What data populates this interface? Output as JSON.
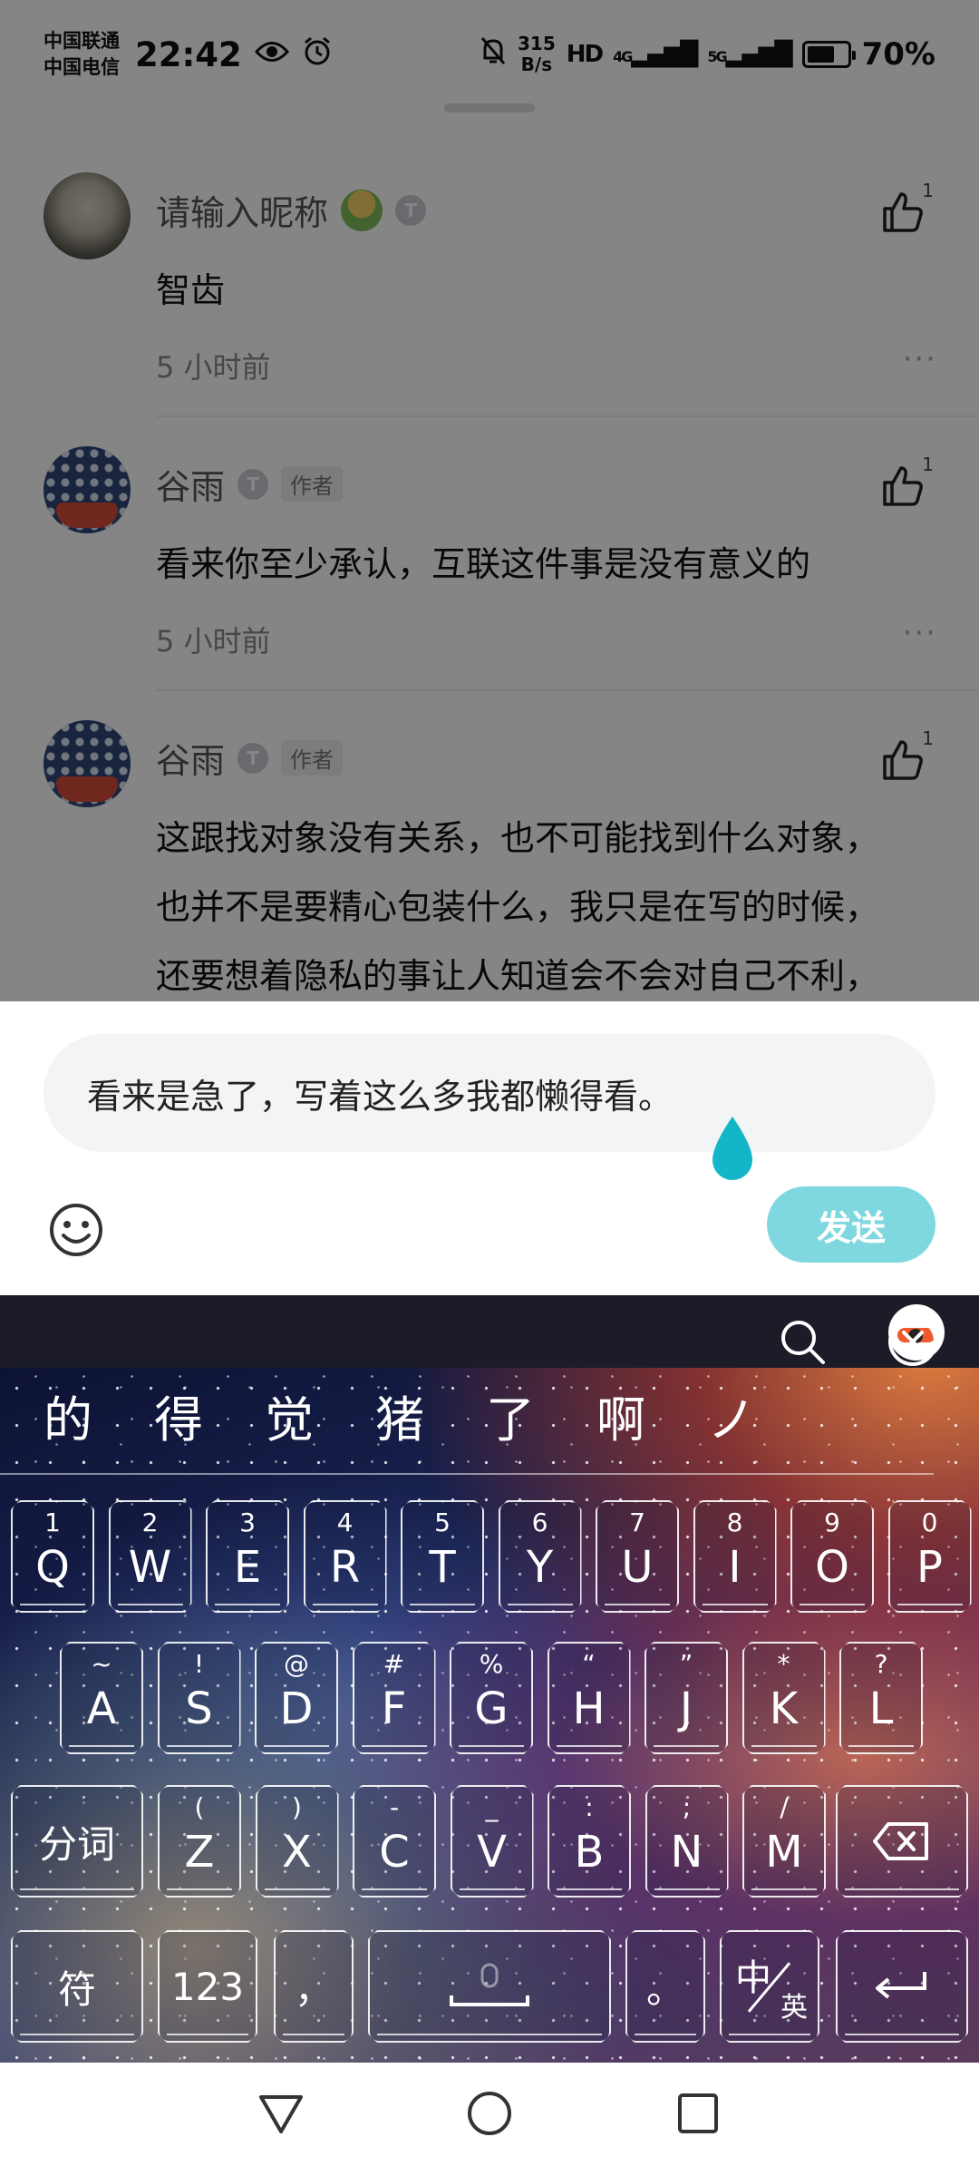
{
  "status_bar": {
    "carrier_1": "中国联通",
    "carrier_2": "中国电信",
    "time": "22:42",
    "net_speed_value": "315",
    "net_speed_unit": "B/s",
    "hd_label": "HD",
    "signal_1": "4G",
    "signal_2": "5G",
    "battery_percent": "70%",
    "battery_level": 0.7
  },
  "comments": [
    {
      "username": "请输入昵称",
      "author_tag": "",
      "text": [
        "智齿"
      ],
      "time": "5 小时前",
      "likes": "1",
      "more": "···"
    },
    {
      "username": "谷雨",
      "author_tag": "作者",
      "text": [
        "看来你至少承认，互联这件事是没有意义的"
      ],
      "time": "5 小时前",
      "likes": "1",
      "more": "···"
    },
    {
      "username": "谷雨",
      "author_tag": "作者",
      "text": [
        "这跟找对象没有关系，也不可能找到什么对象，",
        "也并不是要精心包装什么，我只是在写的时候，",
        "还要想着隐私的事让人知道会不会对自己不利，"
      ],
      "time": "",
      "likes": "1",
      "more": ""
    }
  ],
  "badge_letter": "T",
  "reply": {
    "input_value": "看来是急了，写着这么多我都懒得看。",
    "send_label": "发送"
  },
  "keyboard": {
    "candidates": [
      "的",
      "得",
      "觉",
      "猪",
      "了",
      "啊",
      "ノ"
    ],
    "row1": [
      {
        "main": "Q",
        "sub": "1"
      },
      {
        "main": "W",
        "sub": "2"
      },
      {
        "main": "E",
        "sub": "3"
      },
      {
        "main": "R",
        "sub": "4"
      },
      {
        "main": "T",
        "sub": "5"
      },
      {
        "main": "Y",
        "sub": "6"
      },
      {
        "main": "U",
        "sub": "7"
      },
      {
        "main": "I",
        "sub": "8"
      },
      {
        "main": "O",
        "sub": "9"
      },
      {
        "main": "P",
        "sub": "0"
      }
    ],
    "row2": [
      {
        "main": "A",
        "sub": "~"
      },
      {
        "main": "S",
        "sub": "!"
      },
      {
        "main": "D",
        "sub": "@"
      },
      {
        "main": "F",
        "sub": "#"
      },
      {
        "main": "G",
        "sub": "%"
      },
      {
        "main": "H",
        "sub": "“"
      },
      {
        "main": "J",
        "sub": "”"
      },
      {
        "main": "K",
        "sub": "*"
      },
      {
        "main": "L",
        "sub": "?"
      }
    ],
    "row3": [
      {
        "main": "Z",
        "sub": "("
      },
      {
        "main": "X",
        "sub": ")"
      },
      {
        "main": "C",
        "sub": "-"
      },
      {
        "main": "V",
        "sub": "_"
      },
      {
        "main": "B",
        "sub": ":"
      },
      {
        "main": "N",
        "sub": ";"
      },
      {
        "main": "M",
        "sub": "/"
      }
    ],
    "segment_label": "分词",
    "symbols_label": "符",
    "numbers_label": "123",
    "comma_label": "，",
    "period_label": "。",
    "lang_zh": "中",
    "lang_en": "英"
  },
  "colors": {
    "send_button": "#7fd8df",
    "cursor_drop": "#12b6c8",
    "dim_overlay": "rgba(0,0,0,0.48)"
  },
  "icons": {
    "like": "thumbs-up-icon",
    "emoji": "smiley-icon",
    "backspace": "backspace-icon",
    "enter": "enter-icon",
    "space": "space-bar-icon"
  }
}
